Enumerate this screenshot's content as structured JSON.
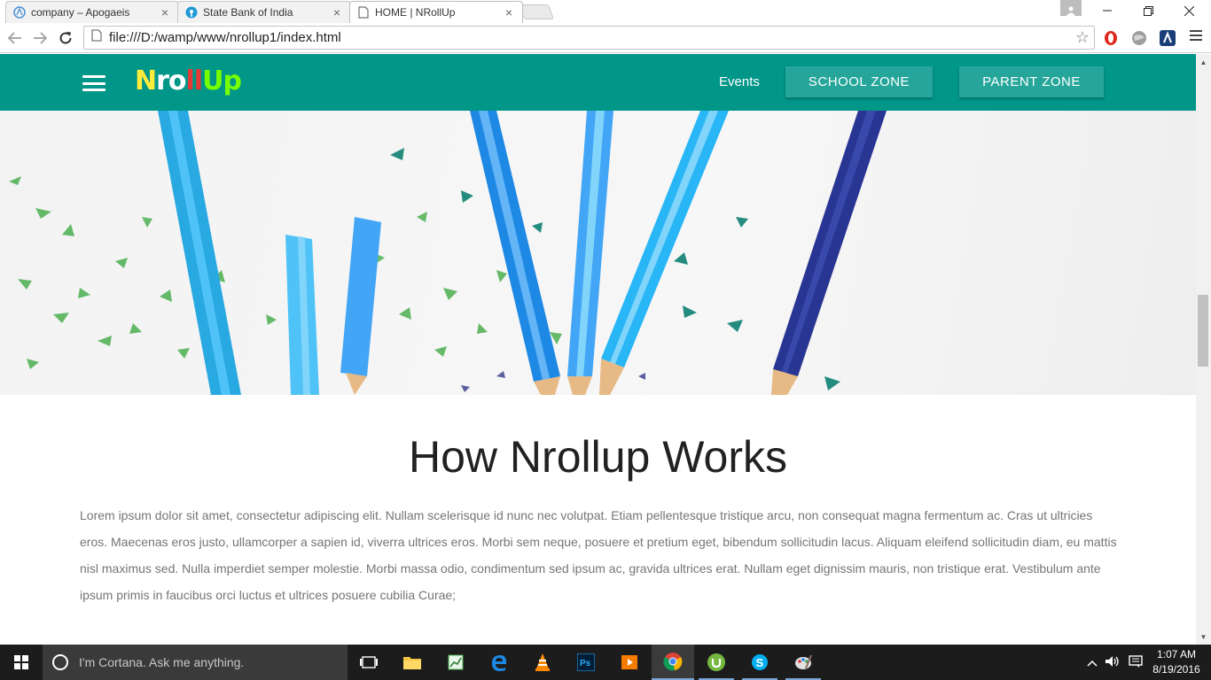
{
  "browser": {
    "tabs": [
      {
        "title": "company – Apogaeis",
        "icon": "apogaeis-icon"
      },
      {
        "title": "State Bank of India",
        "icon": "sbi-icon"
      },
      {
        "title": "HOME | NRollUp",
        "icon": "page-icon"
      }
    ],
    "active_tab": 2,
    "address": "file:///D:/wamp/www/nrollup1/index.html"
  },
  "site": {
    "logo": {
      "part1": "N",
      "part2": "ro",
      "part3": "ll",
      "part4": "Up"
    },
    "nav": {
      "events": "Events",
      "school_zone": "SCHOOL ZONE",
      "parent_zone": "PARENT ZONE"
    },
    "colors": {
      "primary": "#009688",
      "button": "#26a69a"
    },
    "section": {
      "title": "How Nrollup Works",
      "body": "Lorem ipsum dolor sit amet, consectetur adipiscing elit. Nullam scelerisque id nunc nec volutpat. Etiam pellentesque tristique arcu, non consequat magna fermentum ac. Cras ut ultricies eros. Maecenas eros justo, ullamcorper a sapien id, viverra ultrices eros. Morbi sem neque, posuere et pretium eget, bibendum sollicitudin lacus. Aliquam eleifend sollicitudin diam, eu mattis nisl maximus sed. Nulla imperdiet semper molestie. Morbi massa odio, condimentum sed ipsum ac, gravida ultrices erat. Nullam eget dignissim mauris, non tristique erat. Vestibulum ante ipsum primis in faucibus orci luctus et ultrices posuere cubilia Curae;"
    }
  },
  "taskbar": {
    "cortana_placeholder": "I'm Cortana. Ask me anything.",
    "time": "1:07 AM",
    "date": "8/19/2016",
    "apps": [
      "task-view",
      "file-explorer",
      "spreadsheet",
      "edge",
      "vlc",
      "photoshop",
      "media-player",
      "chrome",
      "utorrent",
      "skype",
      "paint"
    ]
  }
}
